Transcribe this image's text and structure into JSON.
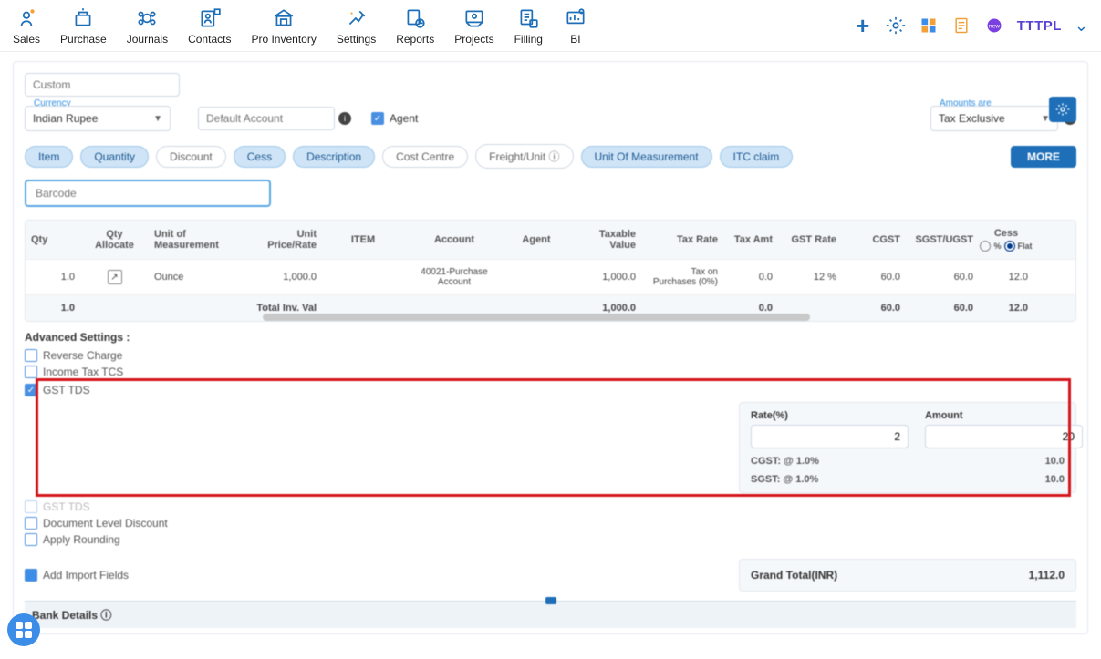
{
  "nav": [
    {
      "label": "Sales"
    },
    {
      "label": "Purchase"
    },
    {
      "label": "Journals"
    },
    {
      "label": "Contacts"
    },
    {
      "label": "Pro Inventory"
    },
    {
      "label": "Settings"
    },
    {
      "label": "Reports"
    },
    {
      "label": "Projects"
    },
    {
      "label": "Filling"
    },
    {
      "label": "BI"
    }
  ],
  "brand": "TTTPL",
  "form": {
    "custom_placeholder": "Custom",
    "currency_label": "Currency",
    "currency_value": "Indian Rupee",
    "default_account_placeholder": "Default Account",
    "agent_label": "Agent",
    "amounts_label": "Amounts are",
    "amounts_value": "Tax Exclusive"
  },
  "pills": [
    {
      "label": "Item",
      "active": true
    },
    {
      "label": "Quantity",
      "active": true
    },
    {
      "label": "Discount",
      "active": false
    },
    {
      "label": "Cess",
      "active": true
    },
    {
      "label": "Description",
      "active": true
    },
    {
      "label": "Cost Centre",
      "active": false
    },
    {
      "label": "Freight/Unit ⓘ",
      "active": false
    },
    {
      "label": "Unit Of Measurement",
      "active": true
    },
    {
      "label": "ITC claim",
      "active": true
    }
  ],
  "more_btn": "MORE",
  "barcode_placeholder": "Barcode",
  "grid": {
    "headers": {
      "qty": "Qty",
      "alloc": "Qty Allocate",
      "uom": "Unit of Measurement",
      "price": "Unit Price/Rate",
      "item": "ITEM",
      "acct": "Account",
      "agent": "Agent",
      "tv": "Taxable Value",
      "tr": "Tax Rate",
      "ta": "Tax Amt",
      "gr": "GST Rate",
      "cg": "CGST",
      "sg": "SGST/UGST",
      "cess": "Cess",
      "pct": "%",
      "flat": "Flat"
    },
    "row": {
      "qty": "1.0",
      "uom": "Ounce",
      "price": "1,000.0",
      "acct": "40021-Purchase Account",
      "tv": "1,000.0",
      "tr": "Tax on Purchases (0%)",
      "ta": "0.0",
      "gr": "12 %",
      "cg": "60.0",
      "sg": "60.0",
      "cess": "12.0"
    },
    "total": {
      "qty": "1.0",
      "label": "Total Inv. Val",
      "tv": "1,000.0",
      "ta": "0.0",
      "cg": "60.0",
      "sg": "60.0",
      "cess": "12.0"
    }
  },
  "adv": {
    "title": "Advanced Settings :",
    "reverse": "Reverse Charge",
    "tcs": "Income Tax TCS",
    "gst_tds": "GST TDS",
    "gst_tds2": "GST TDS",
    "dld": "Document Level Discount",
    "round": "Apply Rounding",
    "add_import": "Add Import Fields"
  },
  "tds": {
    "rate_label": "Rate(%)",
    "rate_value": "2",
    "amount_label": "Amount",
    "amount_value": "20",
    "cgst": "CGST: @ 1.0%",
    "cgst_val": "10.0",
    "sgst": "SGST: @ 1.0%",
    "sgst_val": "10.0"
  },
  "grand_total": {
    "label": "Grand Total(INR)",
    "value": "1,112.0"
  },
  "bank": "Bank Details ⓘ"
}
